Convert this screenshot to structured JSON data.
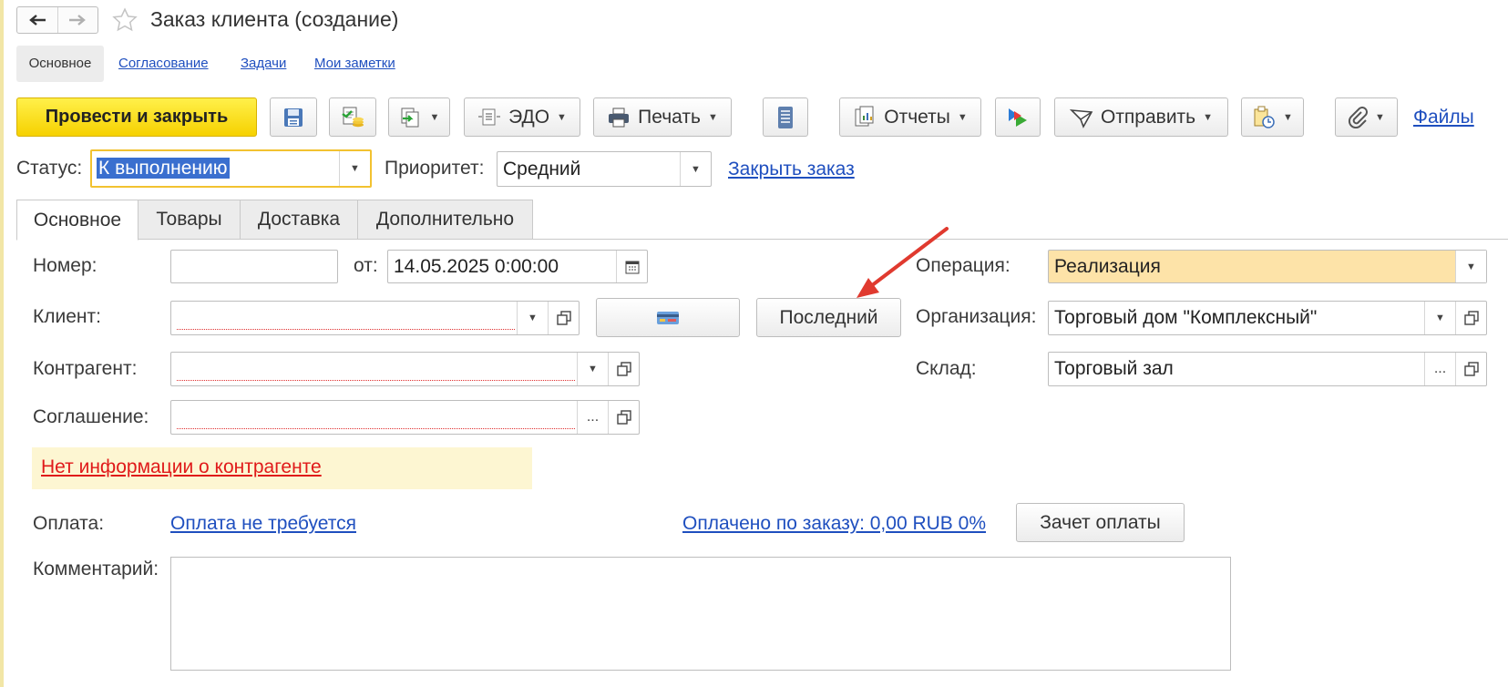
{
  "window": {
    "title": "Заказ клиента (создание)"
  },
  "sections": {
    "active": "Основное",
    "links": [
      "Согласование",
      "Задачи",
      "Мои заметки"
    ]
  },
  "toolbar": {
    "post_close_label": "Провести и закрыть",
    "edo_label": "ЭДО",
    "print_label": "Печать",
    "reports_label": "Отчеты",
    "send_label": "Отправить",
    "files_label": "Файлы"
  },
  "status_row": {
    "status_label": "Статус:",
    "status_value": "К выполнению",
    "priority_label": "Приоритет:",
    "priority_value": "Средний",
    "close_order_link": "Закрыть заказ"
  },
  "tabs": [
    "Основное",
    "Товары",
    "Доставка",
    "Дополнительно"
  ],
  "form": {
    "number_label": "Номер:",
    "number_value": "",
    "from_label": "от:",
    "date_value": "14.05.2025  0:00:00",
    "client_label": "Клиент:",
    "client_value": "",
    "last_button": "Последний",
    "counterparty_label": "Контрагент:",
    "counterparty_value": "",
    "agreement_label": "Соглашение:",
    "agreement_value": "",
    "warning": "Нет информации о контрагенте",
    "operation_label": "Операция:",
    "operation_value": "Реализация",
    "organization_label": "Организация:",
    "organization_value": "Торговый дом \"Комплексный\"",
    "warehouse_label": "Склад:",
    "warehouse_value": "Торговый зал",
    "payment_label": "Оплата:",
    "payment_link": "Оплата не требуется",
    "paid_link": "Оплачено по заказу: 0,00 RUB 0%",
    "offset_button": "Зачет оплаты",
    "comment_label": "Комментарий:",
    "comment_value": "",
    "ellipsis": "..."
  },
  "colors": {
    "primary_button": "#f6d100",
    "link": "#1f4fbf",
    "operation_highlight": "#fde3a8",
    "warning_bg": "#fdf6d2",
    "warning_text": "#e01a1a",
    "arrow": "#e03a2f"
  }
}
